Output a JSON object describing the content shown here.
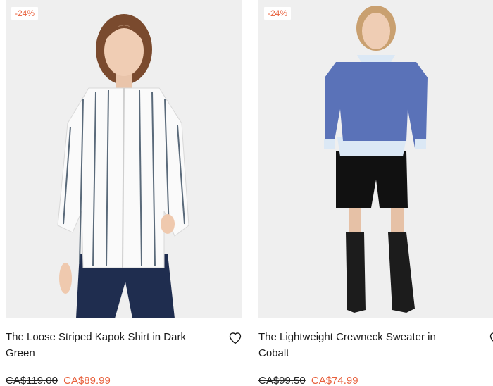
{
  "products": [
    {
      "badge": "-24%",
      "title": "The Loose Striped Kapok Shirt in Dark Green",
      "original_price": "CA$119.00",
      "sale_price": "CA$89.99",
      "image_icon": "model-photo"
    },
    {
      "badge": "-24%",
      "title": "The Lightweight Crewneck Sweater in Cobalt",
      "original_price": "CA$99.50",
      "sale_price": "CA$74.99",
      "image_icon": "model-photo"
    }
  ],
  "colors": {
    "sale": "#e8603c",
    "text": "#1a1a1a",
    "photo_bg": "#efefef"
  }
}
